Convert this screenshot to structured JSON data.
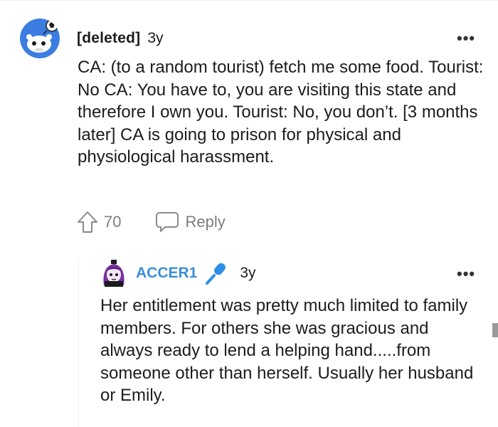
{
  "comment": {
    "author": "[deleted]",
    "age": "3y",
    "more_label": "•••",
    "body": "CA: (to a random tourist) fetch me some food. Tourist: No CA: You have to, you are visiting this state and therefore I own you. Tourist: No, you don’t. [3 months later] CA is going to prison for physical and physiological harassment.",
    "upvote_count": "70",
    "reply_label": "Reply",
    "avatar_icon": "snoo-avatar-icon",
    "upvote_icon": "upvote-arrow-icon",
    "reply_icon": "chat-bubble-icon"
  },
  "reply": {
    "author": "ACCER1",
    "age": "3y",
    "more_label": "•••",
    "body": "Her entitlement was pretty much limited to family members. For others she was gracious and always ready to lend a helping hand.....from someone other than herself. Usually her husband or Emily.",
    "avatar_icon": "purple-hair-avatar-icon",
    "flair_icon": "microphone-icon"
  },
  "colors": {
    "text": "#1c1c1c",
    "muted": "#7c7c7c",
    "username_blue": "#3a8fd8",
    "avatar_bg": "#3b7de0"
  }
}
